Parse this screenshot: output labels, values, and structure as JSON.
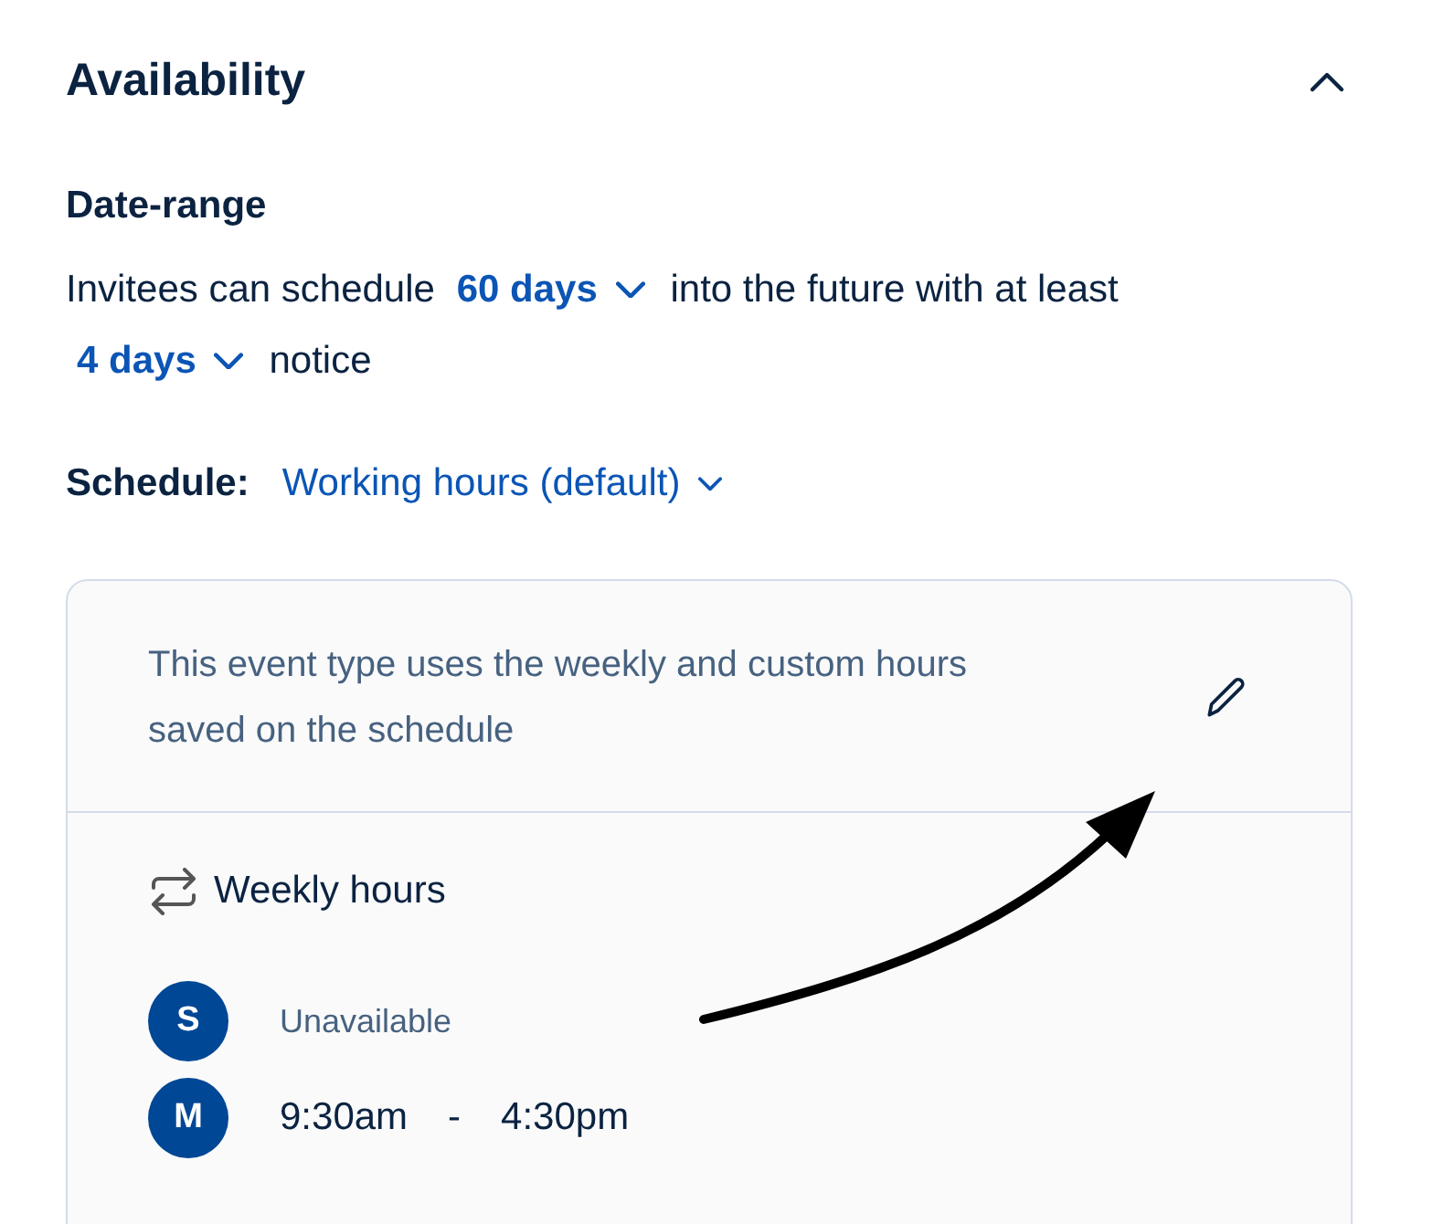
{
  "section": {
    "title": "Availability",
    "expanded": true
  },
  "date_range": {
    "heading": "Date-range",
    "sentence": [
      {
        "kind": "text",
        "text": "Invitees can schedule"
      },
      {
        "kind": "dropdown",
        "text": "60 days"
      },
      {
        "kind": "text",
        "text": "into the future with at least"
      },
      {
        "kind": "dropdown",
        "text": "4 days"
      },
      {
        "kind": "text",
        "text": "notice"
      }
    ]
  },
  "schedule": {
    "label": "Schedule:",
    "value": "Working hours (default)"
  },
  "card": {
    "note": "This event type uses the weekly and custom hours saved on the schedule",
    "weekly_title": "Weekly hours",
    "days": [
      {
        "letter": "S",
        "kind": "unavailable",
        "text": "Unavailable"
      },
      {
        "letter": "M",
        "kind": "hours",
        "start": "9:30am",
        "separator": "-",
        "end": "4:30pm"
      }
    ]
  }
}
